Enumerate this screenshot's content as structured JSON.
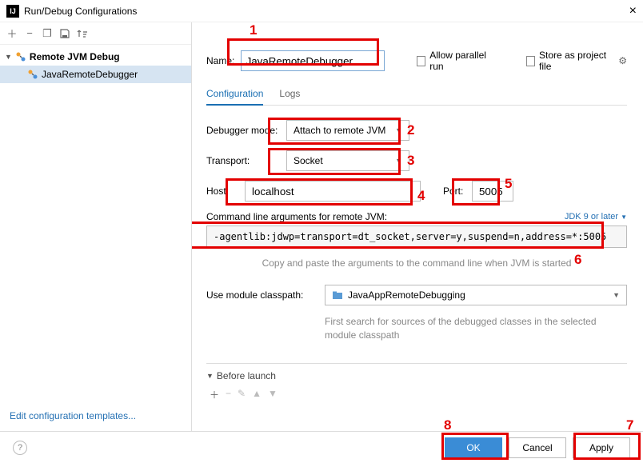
{
  "window": {
    "title": "Run/Debug Configurations",
    "closeGlyph": "×",
    "appIcon": "IJ"
  },
  "sidebar": {
    "editTemplates": "Edit configuration templates...",
    "rootLabel": "Remote JVM Debug",
    "childLabel": "JavaRemoteDebugger"
  },
  "main": {
    "nameLabel": "Name:",
    "nameValue": "JavaRemoteDebugger",
    "allowParallel": "Allow parallel run",
    "storeAsFile": "Store as project file"
  },
  "tabs": {
    "configuration": "Configuration",
    "logs": "Logs"
  },
  "form": {
    "debuggerModeLabel": "Debugger mode:",
    "debuggerModeValue": "Attach to remote JVM",
    "transportLabel": "Transport:",
    "transportValue": "Socket",
    "hostLabel": "Host:",
    "hostValue": "localhost",
    "portLabel": "Port:",
    "portValue": "5005",
    "cmdLabel": "Command line arguments for remote JVM:",
    "jdkLabel": "JDK 9 or later",
    "cmdValue": "-agentlib:jdwp=transport=dt_socket,server=y,suspend=n,address=*:5005",
    "cmdHint": "Copy and paste the arguments to the command line when JVM is started",
    "classpathLabel": "Use module classpath:",
    "classpathValue": "JavaAppRemoteDebugging",
    "classpathHint": "First search for sources of the debugged classes in the selected module classpath"
  },
  "beforeLaunch": {
    "label": "Before launch"
  },
  "footer": {
    "ok": "OK",
    "cancel": "Cancel",
    "apply": "Apply"
  },
  "annotations": {
    "1": "1",
    "2": "2",
    "3": "3",
    "4": "4",
    "5": "5",
    "6": "6",
    "7": "7",
    "8": "8"
  }
}
